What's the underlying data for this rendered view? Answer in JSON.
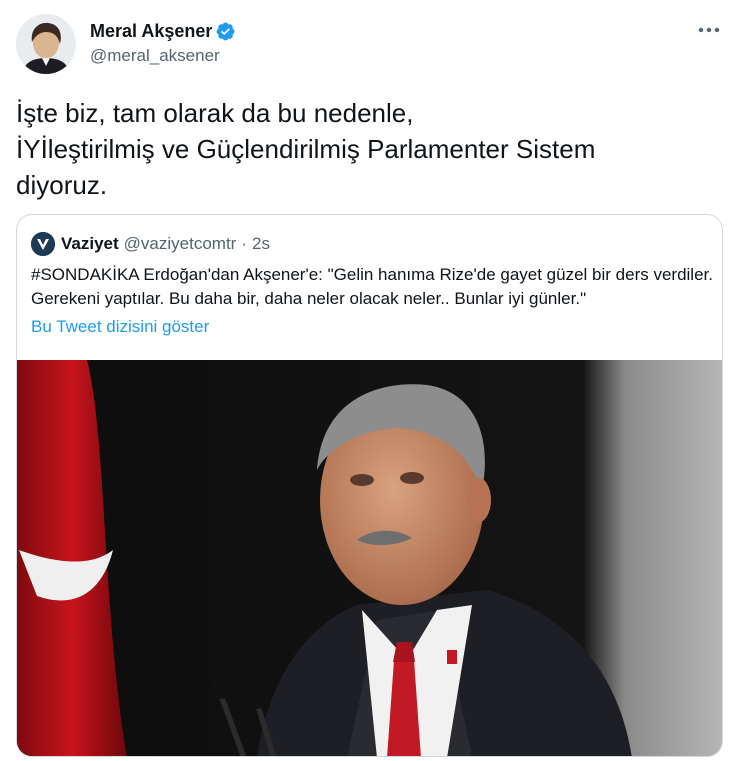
{
  "author": {
    "display_name": "Meral Akşener",
    "handle": "@meral_aksener",
    "verified": true
  },
  "icons": {
    "verified": "verified-badge-icon",
    "more": "more-options-icon",
    "quote_avatar": "vaziyet-logo-icon"
  },
  "tweet": {
    "text": "İşte biz, tam olarak da bu nedenle,\nİYİleştirilmiş ve Güçlendirilmiş Parlamenter Sistem\ndiyoruz."
  },
  "quoted_tweet": {
    "display_name": "Vaziyet",
    "handle": "@vaziyetcomtr",
    "separator": "·",
    "time": "2s",
    "text": "#SONDAKİKA Erdoğan'dan Akşener'e: \"Gelin hanıma Rize'de gayet güzel bir ders verdiler. Gerekeni yaptılar. Bu daha bir, daha neler olacak neler.. Bunlar iyi günler.\"",
    "thread_link": "Bu Tweet dizisini göster"
  },
  "colors": {
    "accent": "#1d9bf0",
    "secondary_text": "#536471",
    "border": "#cfd9de"
  }
}
